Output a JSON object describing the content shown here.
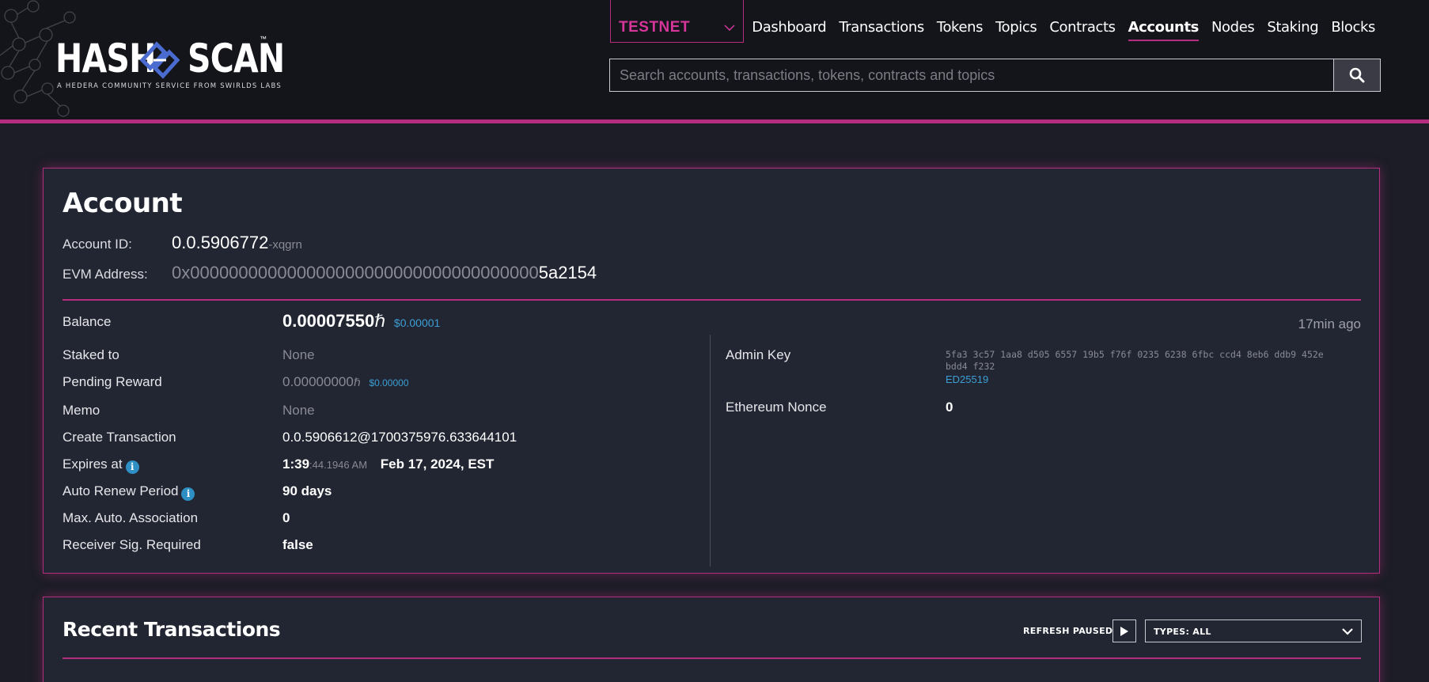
{
  "header": {
    "logo": {
      "word_left": "HASH",
      "word_right": "SCAN",
      "trademark": "™",
      "tagline": "A HEDERA COMMUNITY SERVICE FROM SWIRLDS LABS"
    },
    "network": "TESTNET",
    "nav": [
      {
        "label": "Dashboard",
        "active": false
      },
      {
        "label": "Transactions",
        "active": false
      },
      {
        "label": "Tokens",
        "active": false
      },
      {
        "label": "Topics",
        "active": false
      },
      {
        "label": "Contracts",
        "active": false
      },
      {
        "label": "Accounts",
        "active": true
      },
      {
        "label": "Nodes",
        "active": false
      },
      {
        "label": "Staking",
        "active": false
      },
      {
        "label": "Blocks",
        "active": false
      }
    ],
    "search_placeholder": "Search accounts, transactions, tokens, contracts and topics"
  },
  "account": {
    "title": "Account",
    "account_id_label": "Account ID:",
    "account_id": "0.0.5906772",
    "account_id_checksum": "-xqgrn",
    "evm_label": "EVM Address:",
    "evm_prefix": "0x000000000000000000000000000000000000",
    "evm_suffix": "5a2154",
    "balance_label": "Balance",
    "balance_value": "0.00007550",
    "balance_unit": "ℏ",
    "balance_usd": "$0.00001",
    "balance_ago": "17min ago",
    "staked_label": "Staked to",
    "staked_value": "None",
    "pending_label": "Pending Reward",
    "pending_value": "0.00000000",
    "pending_unit": "ℏ",
    "pending_usd": "$0.00000",
    "memo_label": "Memo",
    "memo_value": "None",
    "create_tx_label": "Create Transaction",
    "create_tx_value": "0.0.5906612@1700375976.633644101",
    "expires_label": "Expires at",
    "expires_time": "1:39",
    "expires_time_detail": ":44.1946 AM",
    "expires_date": "Feb 17, 2024, EST",
    "auto_renew_label": "Auto Renew Period",
    "auto_renew_value": "90 days",
    "max_assoc_label": "Max. Auto. Association",
    "max_assoc_value": "0",
    "receiver_sig_label": "Receiver Sig. Required",
    "receiver_sig_value": "false",
    "admin_key_label": "Admin Key",
    "admin_key_line1": "5fa3 3c57 1aa8 d505 6557 19b5 f76f 0235 6238 6fbc ccd4 8eb6 ddb9 452e",
    "admin_key_line2": "bdd4 f232",
    "admin_key_type": "ED25519",
    "eth_nonce_label": "Ethereum Nonce",
    "eth_nonce_value": "0"
  },
  "recent": {
    "title": "Recent Transactions",
    "refresh_label": "REFRESH PAUSED",
    "types_label": "TYPES: ALL"
  },
  "colors": {
    "accent": "#b52d7f",
    "network": "#d6359a",
    "link": "#3c9ed4",
    "background": "#1c1d26",
    "card": "#222632"
  }
}
